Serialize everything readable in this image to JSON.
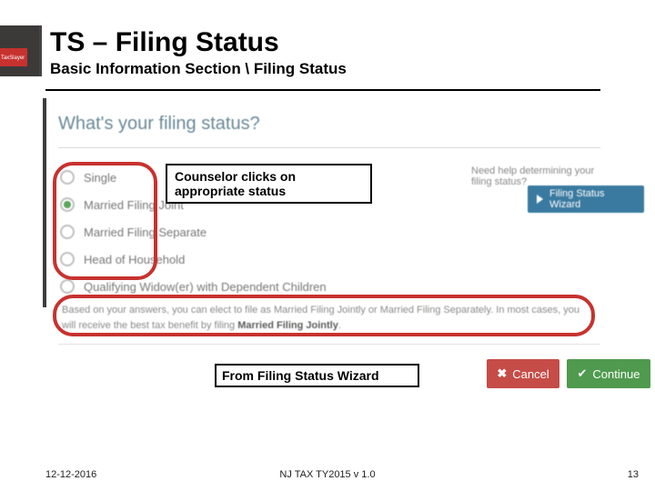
{
  "brand": {
    "logo_text": "TaxSlayer"
  },
  "header": {
    "title": "TS – Filing Status",
    "breadcrumb": "Basic Information Section \\ Filing Status"
  },
  "screenshot": {
    "question": "What's your filing status?",
    "help_text": "Need help determining your filing status?",
    "wizard_button": "Filing Status Wizard",
    "options": [
      {
        "label": "Single",
        "selected": false
      },
      {
        "label": "Married Filing Joint",
        "selected": true
      },
      {
        "label": "Married Filing Separate",
        "selected": false
      },
      {
        "label": "Head of Household",
        "selected": false
      },
      {
        "label": "Qualifying Widow(er) with Dependent Children",
        "selected": false
      }
    ],
    "recommendation_prefix": "Based on your answers, you can elect to file as Married Filing Jointly or Married Filing Separately. In most cases, you will receive the best tax benefit by filing ",
    "recommendation_bold": "Married Filing Jointly",
    "recommendation_suffix": ".",
    "cancel_label": "Cancel",
    "continue_label": "Continue"
  },
  "annotations": {
    "selected_note": "Counselor clicks on appropriate status",
    "wizard_note": "From Filing Status Wizard"
  },
  "footer": {
    "date": "12-12-2016",
    "center": "NJ TAX TY2015 v 1.0",
    "page": "13"
  }
}
